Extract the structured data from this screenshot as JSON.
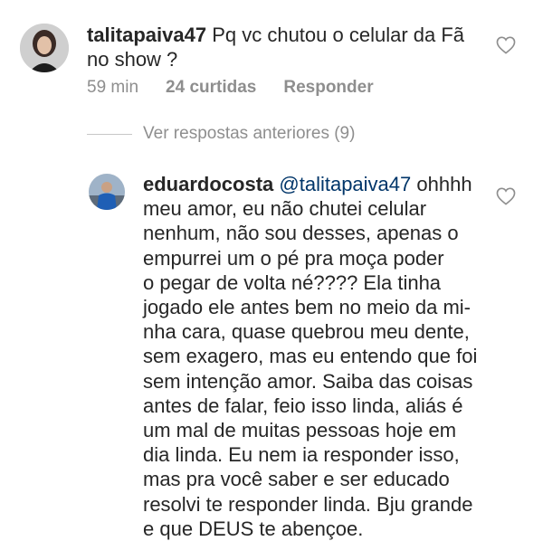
{
  "comment1": {
    "username": "talitapaiva47",
    "text_line1": "Pq vc chutou o celular da Fã",
    "text_line2": "no show ?",
    "time": "59 min",
    "likes": "24 curtidas",
    "reply_label": "Responder"
  },
  "replies": {
    "view_previous": "Ver respostas anteriores (9)"
  },
  "comment2": {
    "username": "eduardocosta",
    "mention": "@talitapaiva47",
    "lines": [
      "ohhhh",
      "meu amor, eu não chutei celular",
      "nenhum, não sou desses, apenas o",
      "empurrei um o pé pra moça poder",
      "o pegar de volta né???? Ela tinha",
      "jogado ele antes bem no meio da mi-",
      "nha cara, quase quebrou meu dente,",
      "sem exagero, mas eu entendo que foi",
      "sem intenção amor. Saiba das coisas",
      "antes de falar, feio isso linda, aliás é",
      "um mal de muitas pessoas hoje em",
      "dia linda. Eu nem ia responder isso,",
      "mas pra você saber e ser educado",
      "resolvi te responder linda. Bju grande",
      "e que DEUS te abençoe."
    ]
  },
  "icons": {
    "avatar1": "user-avatar-talitapaiva47",
    "avatar2": "user-avatar-eduardocosta",
    "like": "heart-outline-icon"
  }
}
